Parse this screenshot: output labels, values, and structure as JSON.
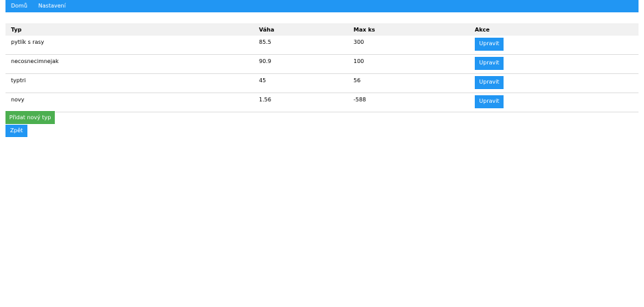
{
  "nav": {
    "items": [
      {
        "label": "Domů"
      },
      {
        "label": "Nastavení"
      }
    ]
  },
  "table": {
    "headers": [
      "Typ",
      "Váha",
      "Max ks",
      "Akce"
    ],
    "rows": [
      {
        "typ": "pytlík s rasy",
        "vaha": "85.5",
        "max_ks": "300",
        "action": "Upravit"
      },
      {
        "typ": "necosnecimnejak",
        "vaha": "90.9",
        "max_ks": "100",
        "action": "Upravit"
      },
      {
        "typ": "typtri",
        "vaha": "45",
        "max_ks": "56",
        "action": "Upravit"
      },
      {
        "typ": "novy",
        "vaha": "1.56",
        "max_ks": "-588",
        "action": "Upravit"
      }
    ]
  },
  "buttons": {
    "add_label": "Přidat nový typ",
    "back_label": "Zpět"
  },
  "colors": {
    "primary": "#2196F3",
    "success": "#4CAF50",
    "header_bg": "#f1f1f1"
  }
}
